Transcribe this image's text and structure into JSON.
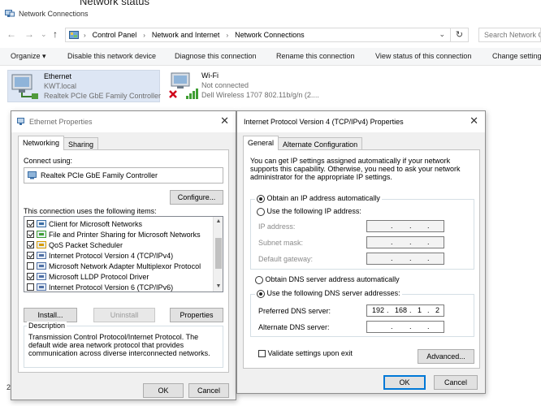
{
  "window": {
    "title_partial": "Network status",
    "title": "Network Connections"
  },
  "address": {
    "crumbs": [
      "Control Panel",
      "Network and Internet",
      "Network Connections"
    ],
    "search_placeholder": "Search Network C"
  },
  "commands": [
    "Organize",
    "Disable this network device",
    "Diagnose this connection",
    "Rename this connection",
    "View status of this connection",
    "Change setting"
  ],
  "adapters": [
    {
      "name": "Ethernet",
      "line2": "KWT.local",
      "line3": "Realtek PCIe GbE Family Controller"
    },
    {
      "name": "Wi-Fi",
      "line2": "Not connected",
      "line3": "Dell Wireless 1707 802.11b/g/n (2...."
    }
  ],
  "eth": {
    "title": "Ethernet Properties",
    "tabs": [
      "Networking",
      "Sharing"
    ],
    "connect_using": "Connect using:",
    "adapter": "Realtek PCIe GbE Family Controller",
    "configure": "Configure...",
    "items_label": "This connection uses the following items:",
    "items": [
      {
        "label": "Client for Microsoft Networks",
        "checked": true
      },
      {
        "label": "File and Printer Sharing for Microsoft Networks",
        "checked": true
      },
      {
        "label": "QoS Packet Scheduler",
        "checked": true
      },
      {
        "label": "Internet Protocol Version 4 (TCP/IPv4)",
        "checked": true
      },
      {
        "label": "Microsoft Network Adapter Multiplexor Protocol",
        "checked": false
      },
      {
        "label": "Microsoft LLDP Protocol Driver",
        "checked": true
      },
      {
        "label": "Internet Protocol Version 6 (TCP/IPv6)",
        "checked": false
      }
    ],
    "install": "Install...",
    "uninstall": "Uninstall",
    "properties": "Properties",
    "description_label": "Description",
    "description": "Transmission Control Protocol/Internet Protocol. The default wide area network protocol that provides communication across diverse interconnected networks.",
    "ok": "OK",
    "cancel": "Cancel"
  },
  "ipv4": {
    "title": "Internet Protocol Version 4 (TCP/IPv4) Properties",
    "tabs": [
      "General",
      "Alternate Configuration"
    ],
    "intro": "You can get IP settings assigned automatically if your network supports this capability. Otherwise, you need to ask your network administrator for the appropriate IP settings.",
    "obtain_ip": "Obtain an IP address automatically",
    "use_ip": "Use the following IP address:",
    "ip_address": "IP address:",
    "subnet_mask": "Subnet mask:",
    "default_gateway": "Default gateway:",
    "obtain_dns": "Obtain DNS server address automatically",
    "use_dns": "Use the following DNS server addresses:",
    "preferred_dns": "Preferred DNS server:",
    "preferred_dns_value": [
      "192",
      "168",
      "1",
      "2"
    ],
    "alternate_dns": "Alternate DNS server:",
    "validate": "Validate settings upon exit",
    "advanced": "Advanced...",
    "ok": "OK",
    "cancel": "Cancel"
  }
}
